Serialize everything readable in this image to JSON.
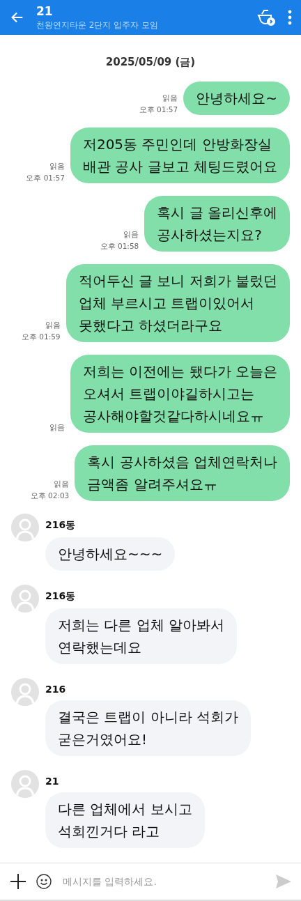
{
  "header": {
    "title": "21",
    "subtitle": "천왕연지타운 2단지 입주자 모임"
  },
  "date": "2025/05/09 (금)",
  "messages": [
    {
      "kind": "sent",
      "text": "안녕하세요~",
      "read": "읽음",
      "time": "오후 01:57"
    },
    {
      "kind": "sent",
      "text": "저205동 주민인데 안방화장실\n배관 공사 글보고 체팅드렸어요",
      "read": "읽음",
      "time": "오후 01:57"
    },
    {
      "kind": "sent",
      "text": "혹시 글 올리신후에\n공사하셨는지요?",
      "read": "읽음",
      "time": "오후 01:58"
    },
    {
      "kind": "sent",
      "text": "적어두신 글 보니 저희가 불렀던\n업체 부르시고 트랩이있어서\n못했다고 하셨더라구요",
      "read": "읽음",
      "time": "오후 01:59"
    },
    {
      "kind": "sent",
      "text": "저희는 이전에는 됐다가 오늘은\n오셔서 트랩이야길하시고는\n공사해야할것같다하시네요ㅠ",
      "read": "읽음"
    },
    {
      "kind": "sent",
      "text": "혹시 공사하셨음 업체연락처나\n금액좀 알려주셔요ㅠ",
      "read": "읽음",
      "time": "오후 02:03"
    },
    {
      "kind": "received",
      "sender": "216동",
      "text": "안녕하세요~~~"
    },
    {
      "kind": "received",
      "sender": "216동",
      "text": "저희는 다른 업체 알아봐서\n연락했는데요"
    },
    {
      "kind": "received",
      "sender": "216",
      "text": "결국은 트랩이 아니라 석회가\n굳은거였어요!"
    },
    {
      "kind": "received",
      "sender": "21",
      "text": "다른 업체에서 보시고\n석회낀거다 라고"
    }
  ],
  "composer": {
    "placeholder": "메시지를 입력하세요."
  }
}
